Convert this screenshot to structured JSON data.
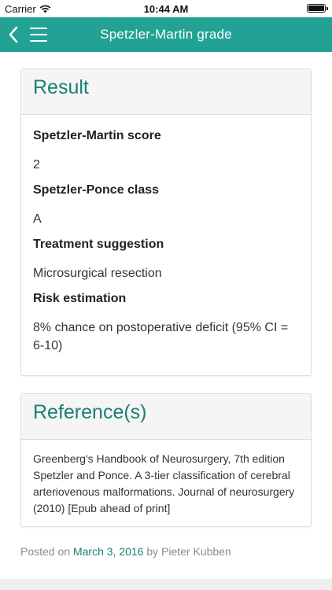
{
  "status_bar": {
    "carrier": "Carrier",
    "time": "10:44 AM",
    "battery_level": 1.0
  },
  "nav": {
    "title": "Spetzler-Martin grade",
    "back_icon": "chevron-left-icon",
    "menu_icon": "hamburger-menu-icon",
    "color": "#21a295"
  },
  "result": {
    "heading": "Result",
    "fields": [
      {
        "label": "Spetzler-Martin score",
        "value": "2"
      },
      {
        "label": "Spetzler-Ponce class",
        "value": "A"
      },
      {
        "label": "Treatment suggestion",
        "value": "Microsurgical resection"
      },
      {
        "label": "Risk estimation",
        "value": "8% chance on postoperative deficit (95% CI = 6-10)"
      }
    ]
  },
  "reference": {
    "heading": "Reference(s)",
    "text": "Greenberg's Handbook of Neurosurgery, 7th edition Spetzler and Ponce. A 3-tier classification of cerebral arteriovenous malformations. Journal of neurosurgery (2010) [Epub ahead of print]"
  },
  "footer": {
    "posted_on": "Posted on",
    "date": "March 3, 2016",
    "by": "by Pieter Kubben"
  },
  "colors": {
    "accent": "#21a295",
    "heading": "#1a7f74"
  }
}
